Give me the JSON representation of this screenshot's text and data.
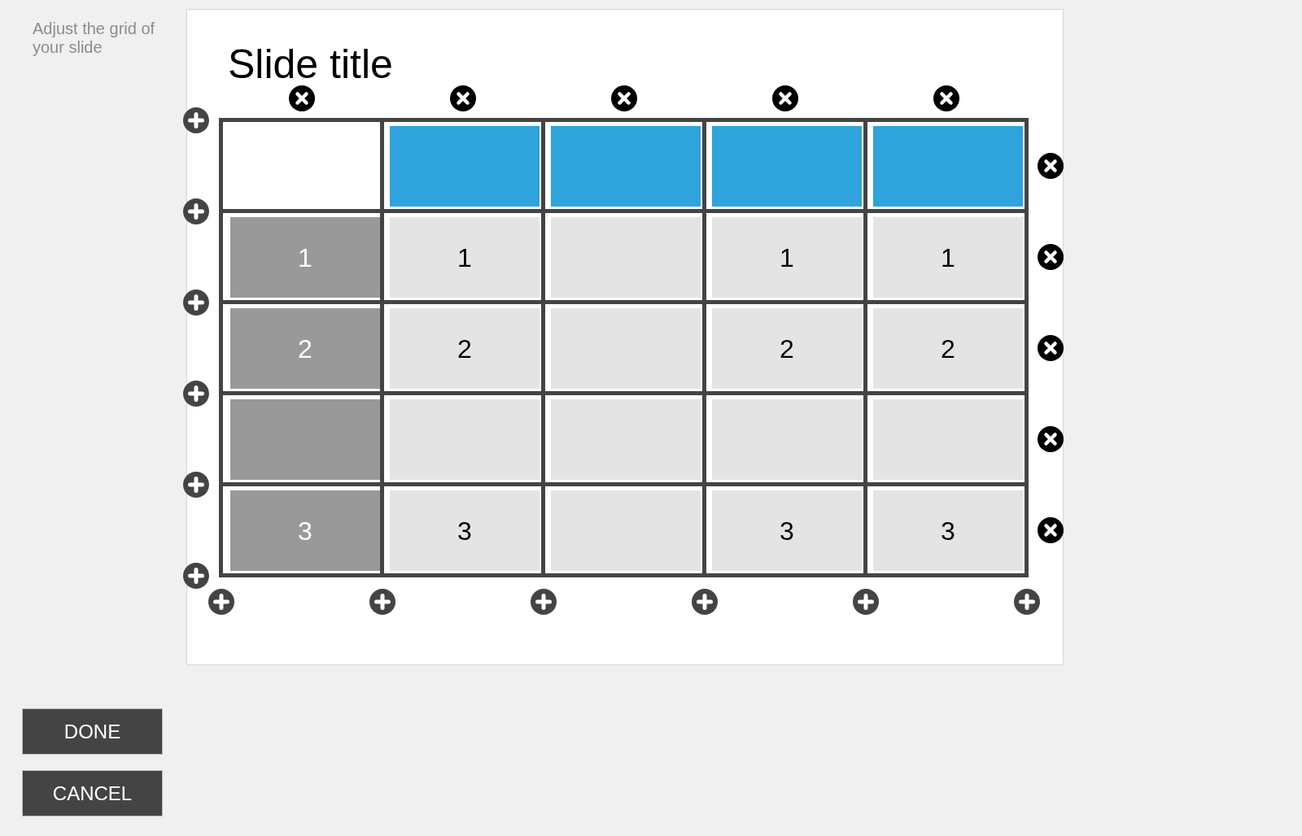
{
  "sidebar": {
    "instruction": "Adjust the grid of your slide"
  },
  "slide": {
    "title": "Slide title",
    "grid": {
      "rows": [
        {
          "cells": [
            {
              "kind": "corner"
            },
            {
              "kind": "header"
            },
            {
              "kind": "header"
            },
            {
              "kind": "header"
            },
            {
              "kind": "header"
            }
          ]
        },
        {
          "cells": [
            {
              "kind": "label",
              "text": "1"
            },
            {
              "kind": "data",
              "text": "1"
            },
            {
              "kind": "data"
            },
            {
              "kind": "data",
              "text": "1"
            },
            {
              "kind": "data",
              "text": "1"
            }
          ]
        },
        {
          "cells": [
            {
              "kind": "label",
              "text": "2"
            },
            {
              "kind": "data",
              "text": "2"
            },
            {
              "kind": "data"
            },
            {
              "kind": "data",
              "text": "2"
            },
            {
              "kind": "data",
              "text": "2"
            }
          ]
        },
        {
          "cells": [
            {
              "kind": "label"
            },
            {
              "kind": "data"
            },
            {
              "kind": "data"
            },
            {
              "kind": "data"
            },
            {
              "kind": "data"
            }
          ]
        },
        {
          "cells": [
            {
              "kind": "label",
              "text": "3"
            },
            {
              "kind": "data",
              "text": "3"
            },
            {
              "kind": "data"
            },
            {
              "kind": "data",
              "text": "3"
            },
            {
              "kind": "data",
              "text": "3"
            }
          ]
        }
      ]
    }
  },
  "buttons": [
    {
      "label": "DONE"
    },
    {
      "label": "CANCEL"
    }
  ]
}
